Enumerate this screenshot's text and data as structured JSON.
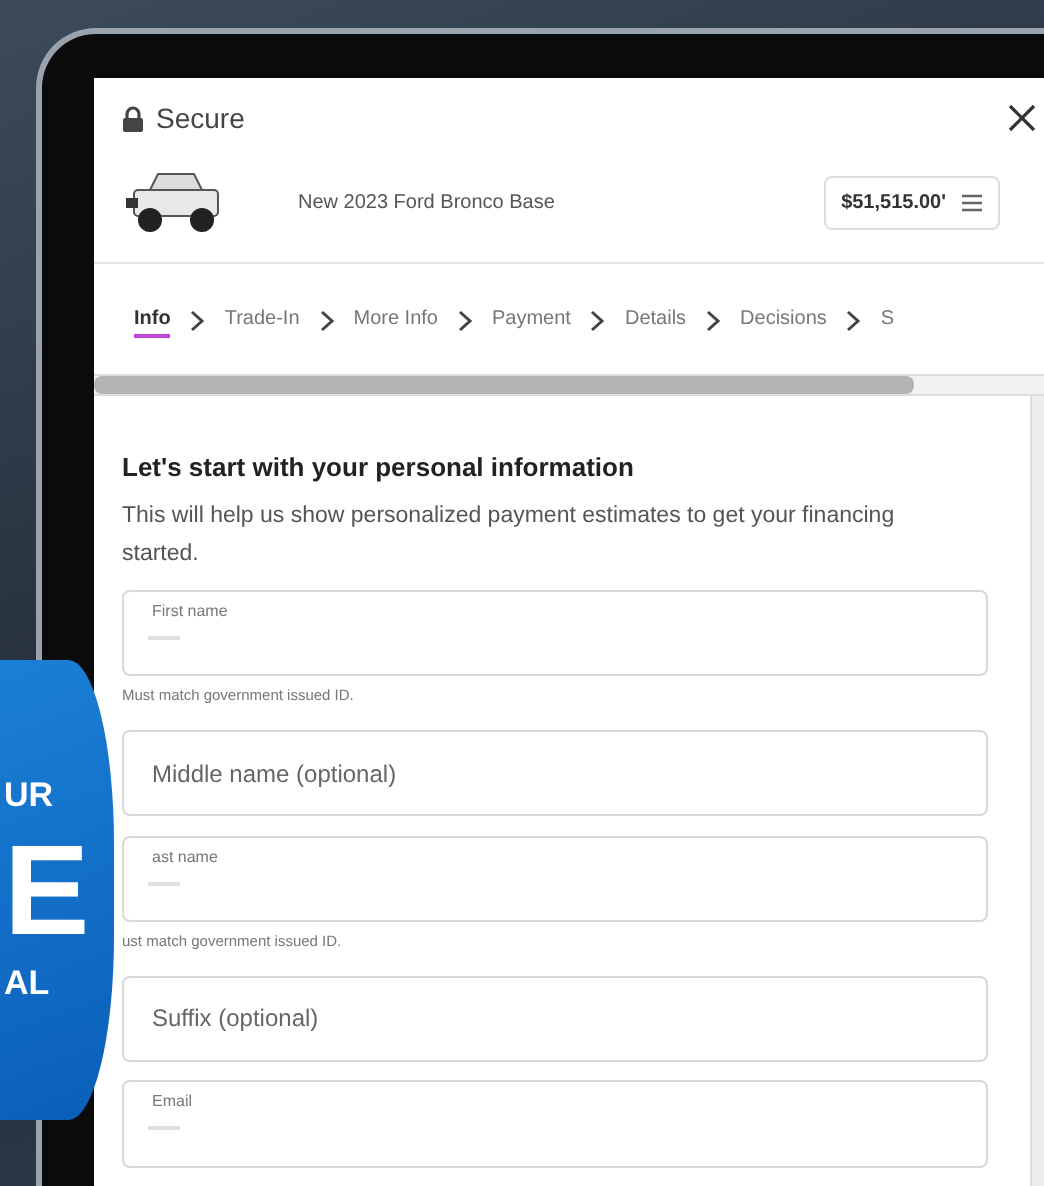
{
  "header": {
    "secure_label": "Secure"
  },
  "vehicle": {
    "name": "New 2023 Ford Bronco Base",
    "price": "$51,515.00'"
  },
  "steps": [
    {
      "label": "Info",
      "selected": true
    },
    {
      "label": "Trade-In",
      "selected": false
    },
    {
      "label": "More Info",
      "selected": false
    },
    {
      "label": "Payment",
      "selected": false
    },
    {
      "label": "Details",
      "selected": false
    },
    {
      "label": "Decisions",
      "selected": false
    },
    {
      "label": "S",
      "selected": false
    }
  ],
  "form": {
    "title": "Let's start with your personal information",
    "intro": "This will help us show personalized payment estimates to get your financing started.",
    "fields": [
      {
        "kind": "labeled",
        "label": "First name",
        "helper": "Must match government issued ID."
      },
      {
        "kind": "placeholder",
        "placeholder": "Middle name (optional)"
      },
      {
        "kind": "labeled",
        "label": "ast name",
        "helper": "ust match government issued ID."
      },
      {
        "kind": "placeholder",
        "placeholder": "Suffix (optional)"
      },
      {
        "kind": "labeled",
        "label": "Email"
      }
    ]
  },
  "badge": {
    "lines": [
      "UR",
      "E",
      "AL"
    ]
  }
}
